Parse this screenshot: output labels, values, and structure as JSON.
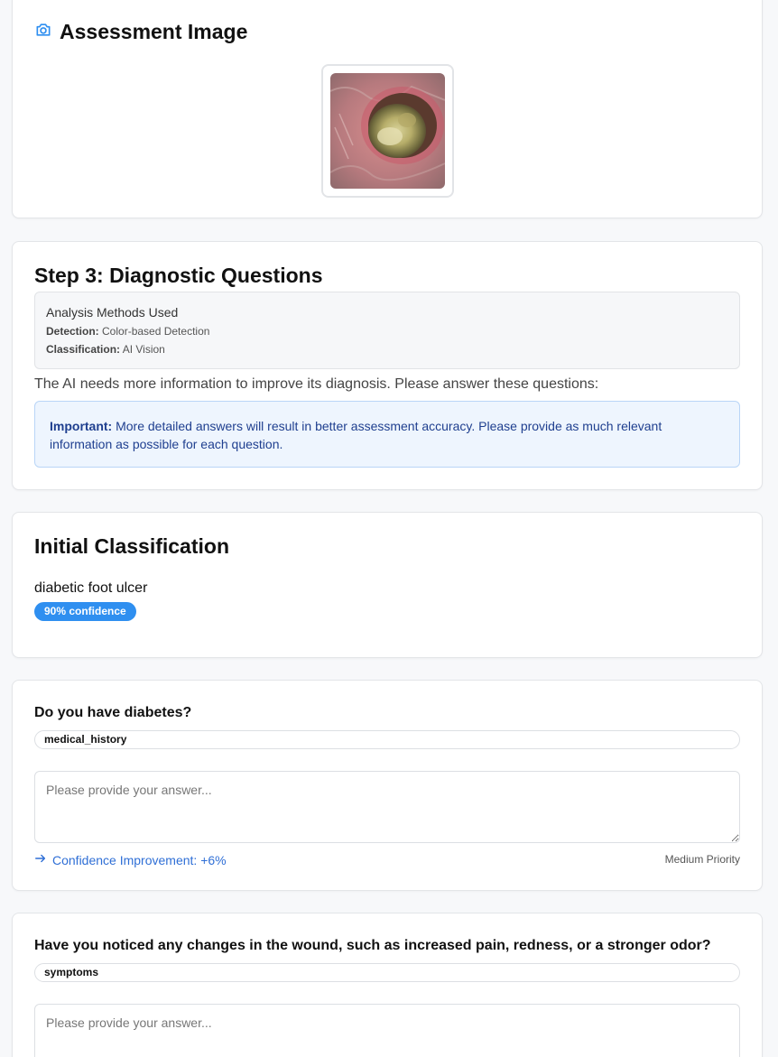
{
  "assessment_image": {
    "title": "Assessment Image",
    "icon": "camera-icon"
  },
  "step": {
    "title": "Step 3: Diagnostic Questions",
    "methods": {
      "heading": "Analysis Methods Used",
      "detection_label": "Detection:",
      "detection_value": "Color-based Detection",
      "classification_label": "Classification:",
      "classification_value": "AI Vision"
    },
    "intro": "The AI needs more information to improve its diagnosis. Please answer these questions:",
    "important_label": "Important:",
    "important_text": "More detailed answers will result in better assessment accuracy. Please provide as much relevant information as possible for each question."
  },
  "classification": {
    "title": "Initial Classification",
    "name": "diabetic foot ulcer",
    "confidence": "90% confidence",
    "confidence_color": "#2f8ff0"
  },
  "questions": [
    {
      "question": "Do you have diabetes?",
      "category": "medical_history",
      "placeholder": "Please provide your answer...",
      "improvement": "Confidence Improvement: +6%",
      "priority": "Medium Priority"
    },
    {
      "question": "Have you noticed any changes in the wound, such as increased pain, redness, or a stronger odor?",
      "category": "symptoms",
      "placeholder": "Please provide your answer..."
    }
  ],
  "colors": {
    "accent": "#2f8ff0",
    "important_bg": "#eef5fe",
    "important_text": "#1f3f8f"
  }
}
